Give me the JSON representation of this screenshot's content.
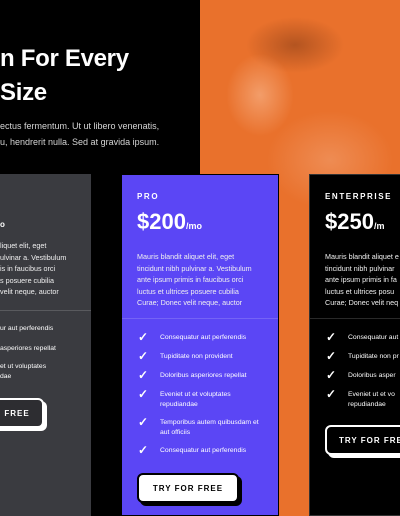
{
  "hero": {
    "headline_line1": "n For Every",
    "headline_line2": "Size",
    "sub_line1": "ectus fermentum. Ut ut libero venenatis,",
    "sub_line2": "u, hendrerit nulla. Sed at gravida ipsum."
  },
  "left": {
    "plan": "o",
    "desc": [
      "liquet elit, eget",
      "ulvinar a. Vestibulum",
      "is in faucibus orci",
      "s posuere cubilia",
      "velit neque, auctor"
    ],
    "features": [
      "ur aut perferendis",
      "asperiores repellat",
      "et ut voluptates",
      "dae"
    ],
    "cta": "FREE"
  },
  "pro": {
    "plan": "PRO",
    "price": "$200",
    "per": "/mo",
    "desc": [
      "Mauris blandit aliquet elit, eget",
      "tincidunt nibh pulvinar a. Vestibulum",
      "ante ipsum primis in faucibus orci",
      "luctus et ultrices posuere cubilia",
      "Curae; Donec velit neque, auctor"
    ],
    "features": [
      [
        "Consequatur aut perferendis"
      ],
      [
        "Tupiditate non provident"
      ],
      [
        "Doloribus asperiores repellat"
      ],
      [
        "Eveniet ut et voluptates",
        "repudiandae"
      ],
      [
        "Temporibus autem quibusdam et",
        "aut officiis"
      ],
      [
        "Consequatur aut perferendis"
      ]
    ],
    "cta": "TRY FOR FREE"
  },
  "enterprise": {
    "plan": "ENTERPRISE",
    "price": "$250",
    "per": "/m",
    "desc": [
      "Mauris blandit aliquet e",
      "tincidunt nibh pulvinar",
      "ante ipsum primis in fa",
      "luctus et ultrices posu",
      "Curae; Donec velit neq"
    ],
    "features": [
      [
        "Consequatur aut"
      ],
      [
        "Tupiditate non pr"
      ],
      [
        "Doloribus asper"
      ],
      [
        "Eveniet ut et vo",
        "repudiandae"
      ]
    ],
    "cta": "TRY FOR FREE"
  },
  "icons": {
    "check": "check-icon"
  },
  "colors": {
    "pro_bg": "#5b46f5",
    "accent_orange": "#e9712c",
    "left_card_bg": "#3a3b40"
  }
}
